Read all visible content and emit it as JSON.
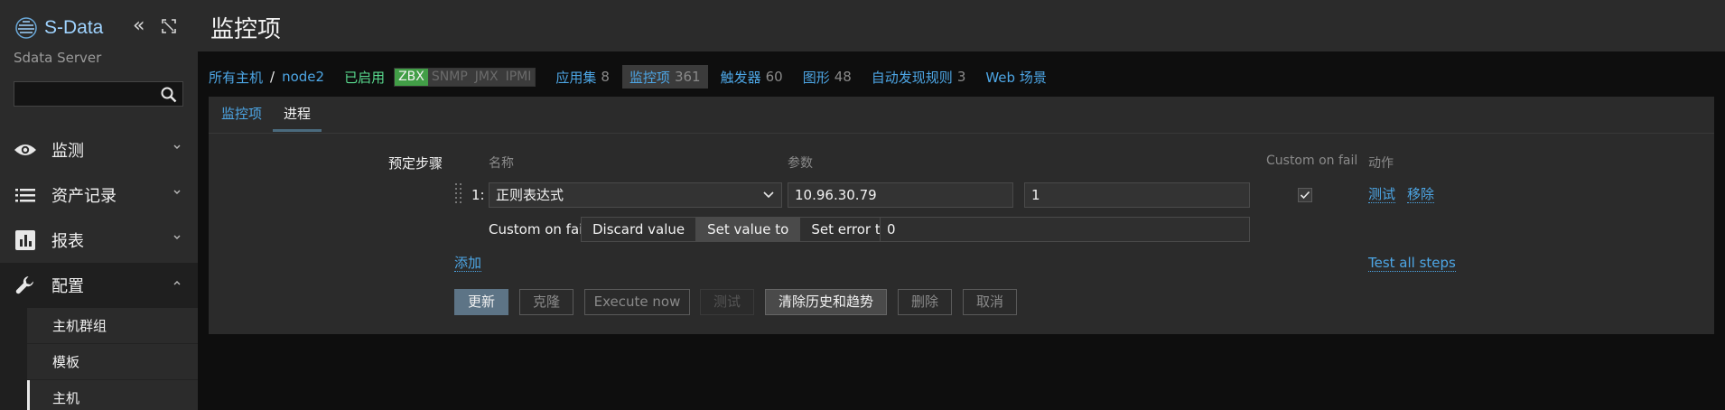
{
  "sidebar": {
    "logo_text": "S-Data",
    "server_name": "Sdata Server",
    "search_placeholder": "",
    "menu": [
      {
        "label": "监测",
        "icon": "eye-icon"
      },
      {
        "label": "资产记录",
        "icon": "list-icon"
      },
      {
        "label": "报表",
        "icon": "bar-chart-icon"
      },
      {
        "label": "配置",
        "icon": "wrench-icon"
      }
    ],
    "submenu": [
      {
        "label": "主机群组"
      },
      {
        "label": "模板"
      },
      {
        "label": "主机"
      }
    ]
  },
  "header": {
    "title": "监控项"
  },
  "nav": {
    "all_hosts": "所有主机",
    "separator": "/",
    "host": "node2",
    "status": "已启用",
    "protocols": [
      "ZBX",
      "SNMP",
      "JMX",
      "IPMI"
    ],
    "items": [
      {
        "label": "应用集",
        "count": "8"
      },
      {
        "label": "监控项",
        "count": "361"
      },
      {
        "label": "触发器",
        "count": "60"
      },
      {
        "label": "图形",
        "count": "48"
      },
      {
        "label": "自动发现规则",
        "count": "3"
      },
      {
        "label": "Web 场景",
        "count": ""
      }
    ]
  },
  "tabs": [
    "监控项",
    "进程"
  ],
  "form": {
    "preprocessing_label": "预定步骤",
    "col_name": "名称",
    "col_params": "参数",
    "col_custom_on_fail": "Custom on fail",
    "col_action": "动作",
    "step_number": "1:",
    "step_type": "正则表达式",
    "param1": "10.96.30.79",
    "param2": "1",
    "custom_on_fail_checked": true,
    "action_test": "测试",
    "action_remove": "移除",
    "cof_label": "Custom on fail",
    "cof_options": [
      "Discard value",
      "Set value to",
      "Set error to"
    ],
    "cof_selected": "Set value to",
    "cof_value": "0",
    "add_link": "添加",
    "test_all": "Test all steps"
  },
  "buttons": {
    "update": "更新",
    "clone": "克隆",
    "execute_now": "Execute now",
    "test": "测试",
    "clear_history": "清除历史和趋势",
    "delete": "删除",
    "cancel": "取消"
  }
}
